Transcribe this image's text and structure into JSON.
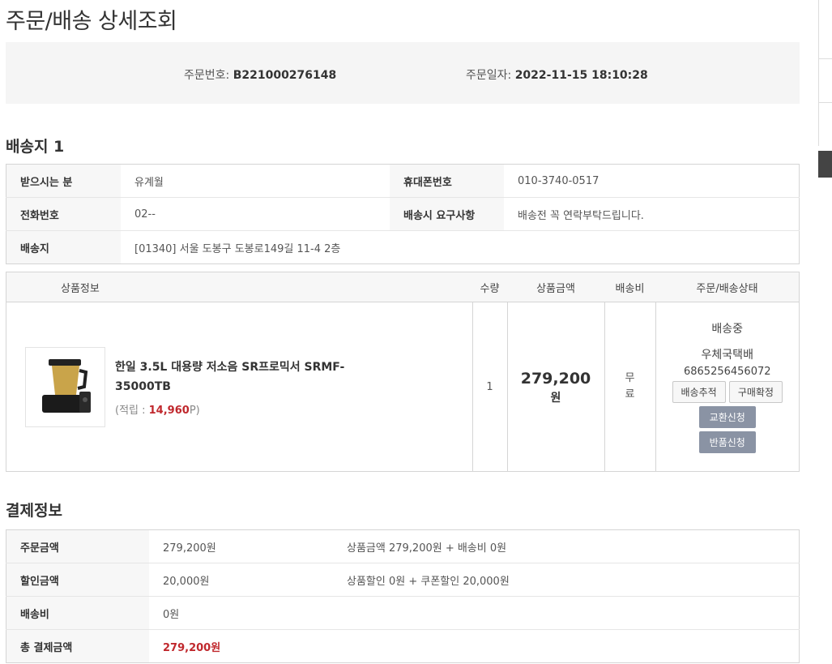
{
  "page_title": "주문/배송 상세조회",
  "order": {
    "no_label": "주문번호: ",
    "no_value": "B221000276148",
    "date_label": "주문일자: ",
    "date_value": "2022-11-15 18:10:28"
  },
  "shipping": {
    "title": "배송지 1",
    "recipient_label": "받으시는 분",
    "recipient_value": "유계월",
    "mobile_label": "휴대폰번호",
    "mobile_value": "010-3740-0517",
    "phone_label": "전화번호",
    "phone_value": "02--",
    "request_label": "배송시 요구사항",
    "request_value": "배송전 꼭 연락부탁드립니다.",
    "address_label": "배송지",
    "address_value": "[01340] 서울 도봉구 도봉로149길 11-4 2층"
  },
  "product_table": {
    "headers": [
      "상품정보",
      "수량",
      "상품금액",
      "배송비",
      "주문/배송상태"
    ],
    "item": {
      "name": "한일 3.5L 대용량 저소음 SR프로믹서 SRMF-35000TB",
      "points_prefix": "(적립 : ",
      "points_value": "14,960",
      "points_suffix": "P)",
      "quantity": "1",
      "price": "279,200",
      "price_unit": "원",
      "shipping_fee_1": "무",
      "shipping_fee_2": "료",
      "status": "배송중",
      "carrier": "우체국택배",
      "tracking_no": "6865256456072",
      "btn_track": "배송추적",
      "btn_confirm": "구매확정",
      "btn_exchange": "교환신청",
      "btn_return": "반품신청"
    }
  },
  "payment": {
    "title": "결제정보",
    "rows": [
      {
        "label": "주문금액",
        "value": "279,200원",
        "detail": "상품금액 279,200원 + 배송비 0원"
      },
      {
        "label": "할인금액",
        "value": "20,000원",
        "detail": "상품할인 0원 + 쿠폰할인 20,000원"
      },
      {
        "label": "배송비",
        "value": "0원",
        "detail": ""
      },
      {
        "label": "총 결제금액",
        "value": "279,200원",
        "detail": ""
      }
    ]
  },
  "colors": {
    "accent_red": "#c0282d",
    "button_dark": "#8a93a4",
    "box_bg": "#f5f5f5"
  },
  "icons": {
    "product_thumbnail": "mixer-product-image"
  }
}
